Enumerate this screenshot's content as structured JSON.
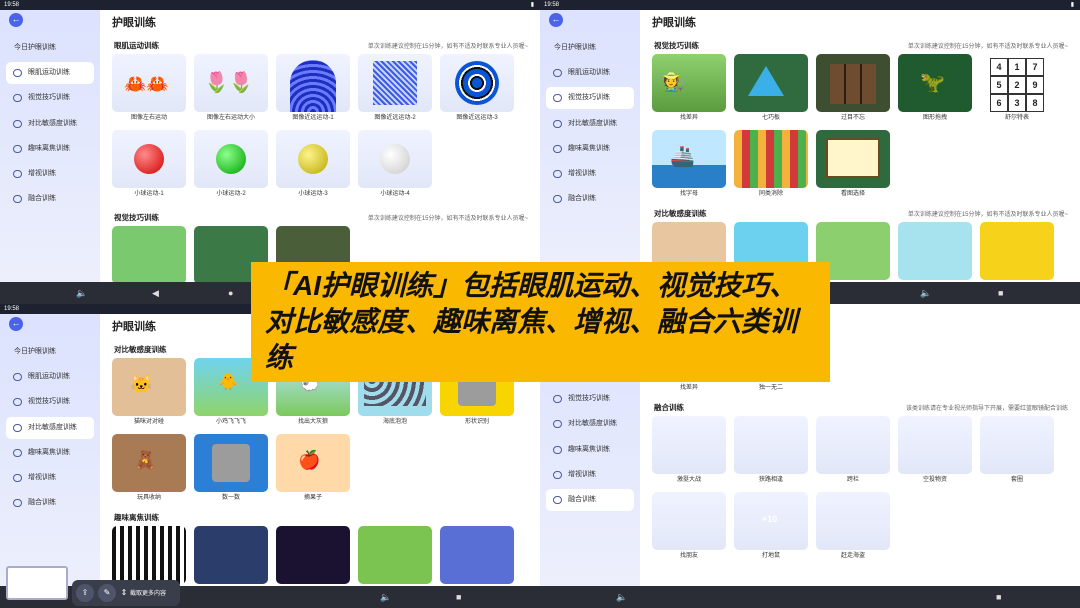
{
  "status": {
    "time": "19:58"
  },
  "sidebar": {
    "today": "今日护眼训练",
    "items": [
      "眼肌运动训练",
      "视觉技巧训练",
      "对比敏感度训练",
      "趣味离焦训练",
      "增视训练",
      "融合训练"
    ]
  },
  "page_title": "护眼训练",
  "note_short": "单次训练建议控制在15分钟，如有不适及时联系专业人员喔~",
  "fusion_note": "该类训练请在专业视光师指导下开展，需要红蓝眼镜配合训练",
  "sections": {
    "eye_muscle": {
      "title": "眼肌运动训练",
      "cards": [
        "图像左右运动",
        "图像左右运动大小",
        "图像近远运动-1",
        "图像近远运动-2",
        "图像近远运动-3",
        "小球运动-1",
        "小球运动-2",
        "小球运动-3",
        "小球运动-4"
      ]
    },
    "visual_skill": {
      "title": "视觉技巧训练",
      "cards": [
        "找差异",
        "七巧板",
        "过目不忘",
        "图形拖拽",
        "舒尔特表",
        "找字母",
        "同类消除",
        "看图选择"
      ]
    },
    "contrast": {
      "title": "对比敏感度训练",
      "cards": [
        "猫咪对对碰",
        "小鸡飞飞飞",
        "找出大灰狼",
        "海底泡泡",
        "形状识别",
        "玩具收纳",
        "数一数",
        "摘果子"
      ]
    },
    "defocus": {
      "title": "趣味离焦训练"
    },
    "fusion": {
      "title": "融合训练",
      "cards": [
        "激挺大战",
        "狭路相逢",
        "跨栏",
        "空投物资",
        "套圈",
        "找朋友",
        "打地鼠",
        "赶走海盗"
      ]
    },
    "q4_top_cards": [
      "找差异",
      "独一无二"
    ]
  },
  "schulte": [
    "4",
    "1",
    "7",
    "5",
    "2",
    "9",
    "6",
    "3",
    "8"
  ],
  "number_badge": "+10",
  "banner": {
    "text": "「AI护眼训练」包括眼肌运动、视觉技巧、对比敏感度、趣味离焦、增视、融合六类训练"
  },
  "fab": {
    "label": "截取更多内容"
  },
  "colors": {
    "accent": "#4a63e8",
    "banner": "#fbb800",
    "fusion": "#e600e6"
  }
}
